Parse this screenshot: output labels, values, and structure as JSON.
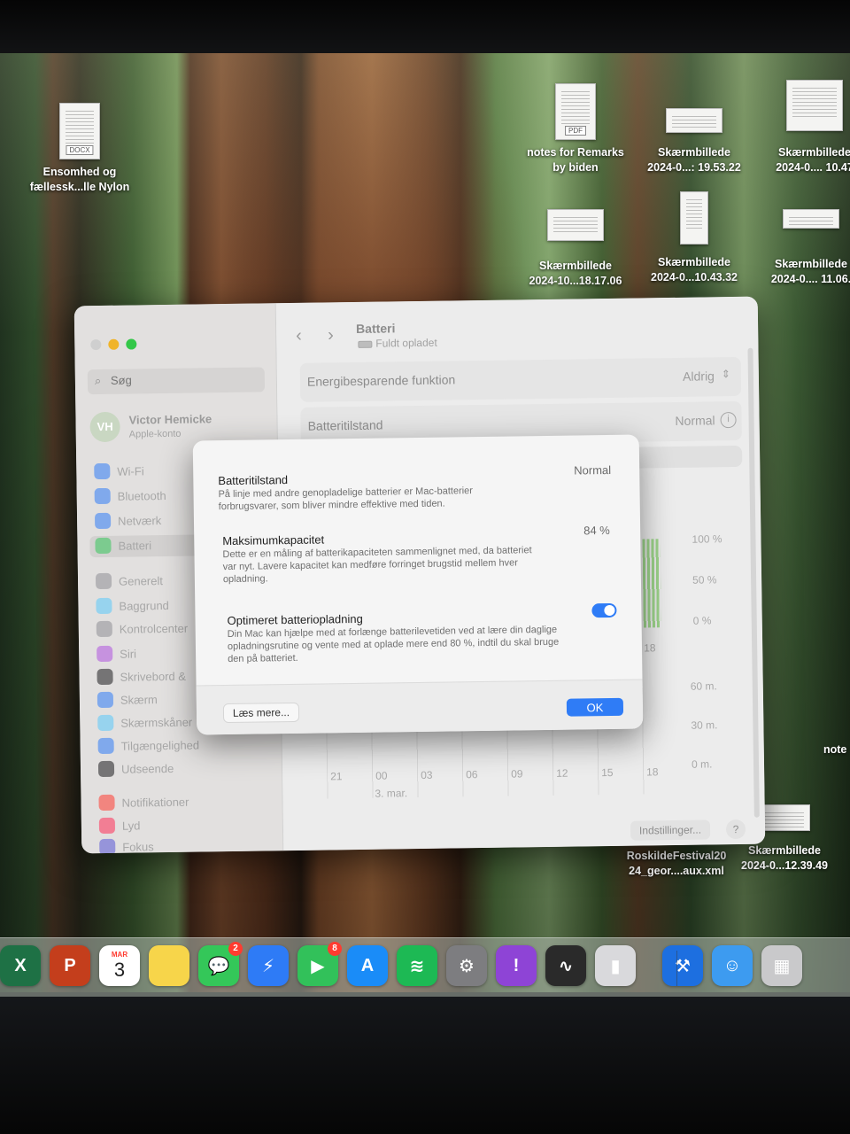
{
  "desktop": {
    "icons": [
      {
        "label1": "Ensomhed og",
        "label2": "fællessk...lle Nylon",
        "tag": "DOCX"
      },
      {
        "label1": "notes for Remarks",
        "label2": "by biden",
        "tag": "PDF"
      },
      {
        "label1": "Skærmbillede",
        "label2": "2024-0...: 19.53.22"
      },
      {
        "label1": "Skærmbillede",
        "label2": "2024-0.... 10.47"
      },
      {
        "label1": "Skærmbillede",
        "label2": "2024-10...18.17.06"
      },
      {
        "label1": "Skærmbillede",
        "label2": "2024-0...10.43.32"
      },
      {
        "label1": "Skærmbillede",
        "label2": "2024-0.... 11.06."
      },
      {
        "label1": "RoskildeFestival20",
        "label2": "24_geor....aux.xml"
      },
      {
        "label1": "Skærmbillede",
        "label2": "2024-0...12.39.49"
      },
      {
        "label1": "note",
        "label2": ""
      }
    ]
  },
  "settings": {
    "search_placeholder": "Søg",
    "account": {
      "initials": "VH",
      "name": "Victor Hemicke",
      "sub": "Apple-konto"
    },
    "sidebar": {
      "items": [
        {
          "label": "Wi-Fi",
          "color": "#2f7cf6"
        },
        {
          "label": "Bluetooth",
          "color": "#2f7cf6"
        },
        {
          "label": "Netværk",
          "color": "#2f7cf6"
        },
        {
          "label": "Batteri",
          "color": "#34c759"
        },
        {
          "label": "Generelt",
          "color": "#8e8e93"
        },
        {
          "label": "Baggrund",
          "color": "#5ac8fa"
        },
        {
          "label": "Kontrolcenter",
          "color": "#8e8e93"
        },
        {
          "label": "Siri",
          "color": "#af52de"
        },
        {
          "label": "Skrivebord &",
          "color": "#1c1c1e"
        },
        {
          "label": "Skærm",
          "color": "#2f7cf6"
        },
        {
          "label": "Skærmskåner",
          "color": "#5ac8fa"
        },
        {
          "label": "Tilgængelighed",
          "color": "#2f7cf6"
        },
        {
          "label": "Udseende",
          "color": "#1c1c1e"
        },
        {
          "label": "Notifikationer",
          "color": "#ff3b30"
        },
        {
          "label": "Lyd",
          "color": "#ff2d55"
        },
        {
          "label": "Fokus",
          "color": "#5856d6"
        }
      ]
    },
    "header": {
      "title": "Batteri",
      "subtitle": "Fuldt opladet"
    },
    "rows": {
      "energy": {
        "label": "Energibesparende funktion",
        "value": "Aldrig"
      },
      "health": {
        "label": "Batteritilstand",
        "value": "Normal"
      },
      "partial": "age"
    },
    "chart": {
      "y_top": [
        "100 %",
        "50 %",
        "0 %"
      ],
      "y_bottom": [
        "60 m.",
        "30 m.",
        "0 m."
      ],
      "x_top_partial": "18",
      "x_ticks": [
        "21",
        "00",
        "03",
        "06",
        "09",
        "12",
        "15",
        "18"
      ],
      "x_date": "3. mar."
    },
    "footer": {
      "settings_btn": "Indstillinger...",
      "help_btn": "?"
    }
  },
  "modal": {
    "health": {
      "title": "Batteritilstand",
      "value": "Normal",
      "desc1": "På linje med andre genopladelige batterier er Mac-batterier",
      "desc2": "forbrugsvarer, som bliver mindre effektive med tiden."
    },
    "capacity": {
      "title": "Maksimumkapacitet",
      "value": "84 %",
      "desc1": "Dette er en måling af batterikapaciteten sammenlignet med, da batteriet",
      "desc2": "var nyt. Lavere kapacitet kan medføre forringet brugstid mellem hver",
      "desc3": "opladning."
    },
    "optimized": {
      "title": "Optimeret batteriopladning",
      "enabled": true,
      "desc1": "Din Mac kan hjælpe med at forlænge batterilevetiden ved at lære din daglige",
      "desc2": "opladningsrutine og vente med at oplade mere end 80 %, indtil du skal bruge",
      "desc3": "den på batteriet."
    },
    "learn_more": "Læs mere...",
    "ok": "OK"
  },
  "dock": {
    "apps": [
      {
        "name": "excel",
        "glyph": "X",
        "color": "#1e7145"
      },
      {
        "name": "powerpoint",
        "glyph": "P",
        "color": "#c43e1c"
      },
      {
        "name": "calendar",
        "month": "MAR",
        "day": "3"
      },
      {
        "name": "notes",
        "glyph": "",
        "color": "#f7d54a"
      },
      {
        "name": "messages",
        "glyph": "💬",
        "color": "#34c759",
        "badge": "2"
      },
      {
        "name": "messenger",
        "glyph": "⚡",
        "color": "#2e7bf6"
      },
      {
        "name": "facetime",
        "glyph": "▶",
        "color": "#32c15a",
        "badge": "8"
      },
      {
        "name": "app-store",
        "glyph": "A",
        "color": "#1a8cf8"
      },
      {
        "name": "spotify",
        "glyph": "≋",
        "color": "#1db954"
      },
      {
        "name": "system-settings",
        "glyph": "⚙",
        "color": "#7d7d80"
      },
      {
        "name": "feedback",
        "glyph": "!",
        "color": "#8e44d6"
      },
      {
        "name": "activity-monitor",
        "glyph": "∿",
        "color": "#2a2a2a"
      },
      {
        "name": "iphone-mirroring",
        "glyph": "▮",
        "color": "#d9d9dc"
      },
      {
        "name": "xcode",
        "glyph": "⚒",
        "color": "#1d6fe0"
      },
      {
        "name": "finder",
        "glyph": "☺",
        "color": "#3d9bf0"
      },
      {
        "name": "preview",
        "glyph": "▦",
        "color": "#c9c9cb"
      }
    ]
  }
}
